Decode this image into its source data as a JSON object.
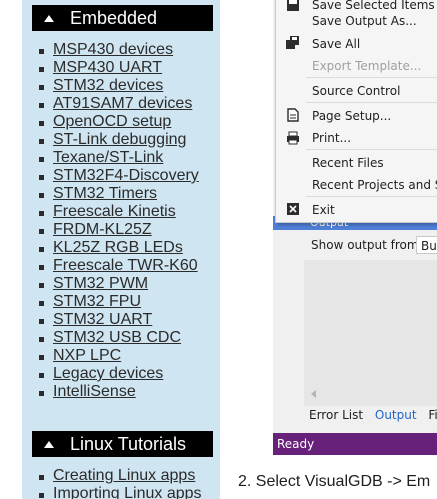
{
  "sidebar": {
    "background": "#cfe5f1",
    "sections": [
      {
        "title": "Embedded",
        "items": [
          "MSP430 devices",
          "MSP430 UART",
          "STM32 devices",
          "AT91SAM7 devices",
          "OpenOCD setup",
          "ST-Link debugging",
          "Texane/ST-Link",
          "STM32F4-Discovery",
          "STM32 Timers",
          "Freescale Kinetis",
          "FRDM-KL25Z",
          "KL25Z RGB LEDs",
          "Freescale TWR-K60",
          "STM32 PWM",
          "STM32 FPU",
          "STM32 UART",
          "STM32 USB CDC",
          "NXP LPC",
          "Legacy devices",
          "IntelliSense"
        ]
      },
      {
        "title": "Linux Tutorials",
        "items": [
          "Creating Linux apps",
          "Importing Linux apps"
        ]
      }
    ]
  },
  "file_menu": {
    "items": [
      {
        "label": "Save Selected Items",
        "disabled": false,
        "icon": "save-icon"
      },
      {
        "label": "Save Output As...",
        "disabled": false,
        "icon": ""
      },
      {
        "label": "Save All",
        "disabled": false,
        "icon": "save-all-icon"
      },
      {
        "label": "Export Template...",
        "disabled": true,
        "icon": ""
      },
      {
        "label": "Source Control",
        "disabled": false,
        "icon": ""
      },
      {
        "label": "Page Setup...",
        "disabled": false,
        "icon": "page-setup-icon"
      },
      {
        "label": "Print...",
        "disabled": false,
        "icon": "print-icon"
      },
      {
        "label": "Recent Files",
        "disabled": false,
        "icon": ""
      },
      {
        "label": "Recent Projects and Solutions",
        "disabled": false,
        "icon": ""
      },
      {
        "label": "Exit",
        "disabled": false,
        "icon": "exit-icon"
      }
    ]
  },
  "output_window": {
    "title": "Output",
    "show_output_label": "Show output from:",
    "show_output_value": "Bui",
    "tabs": [
      "Error List",
      "Output",
      "Find"
    ],
    "active_tab": "Output"
  },
  "statusbar": {
    "text": "Ready",
    "color": "#68217a"
  },
  "instructions": {
    "step": "2.  Select VisualGDB -> Em"
  }
}
